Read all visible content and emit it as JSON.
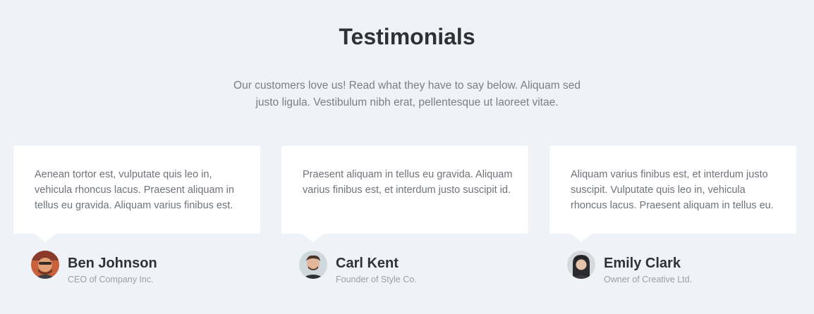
{
  "section": {
    "title": "Testimonials",
    "subtitle_line1": "Our customers love us! Read what they have to say below. Aliquam sed",
    "subtitle_line2": "justo ligula. Vestibulum nibh erat, pellentesque ut laoreet vitae."
  },
  "testimonials": [
    {
      "quote": "Aenean tortor est, vulputate quis leo in, vehicula rhoncus lacus. Praesent aliquam in tellus eu gravida. Aliquam varius finibus est.",
      "name": "Ben Johnson",
      "role": "CEO of Company Inc.",
      "avatar_icon": "avatar-photo-icon"
    },
    {
      "quote": "Praesent aliquam in tellus eu gravida. Aliquam varius finibus est, et interdum justo suscipit id.",
      "name": "Carl Kent",
      "role": "Founder of Style Co.",
      "avatar_icon": "avatar-photo-icon"
    },
    {
      "quote": "Aliquam varius finibus est, et interdum justo suscipit. Vulputate quis leo in, vehicula rhoncus lacus. Praesent aliquam in tellus eu.",
      "name": "Emily Clark",
      "role": "Owner of Creative Ltd.",
      "avatar_icon": "avatar-photo-icon"
    }
  ],
  "colors": {
    "background": "#eff3f7",
    "card": "#ffffff",
    "heading": "#2f3235",
    "body_text": "#6e737a",
    "muted_text": "#9aa0a6"
  }
}
